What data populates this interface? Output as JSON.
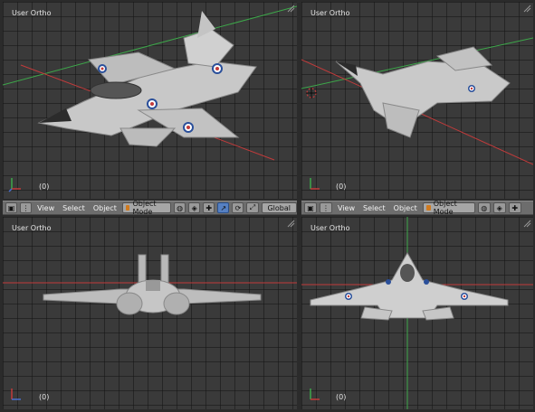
{
  "colors": {
    "viewport_bg": "#3a3a3a",
    "grid": "#202020",
    "header_bg": "#6d6d6d",
    "axis_red": "#c23b3b",
    "axis_green": "#3da84a",
    "mode_orange": "#d07a1f",
    "pressed_blue": "#5680c2"
  },
  "viewports": [
    {
      "title": "User Ortho",
      "frame": "(0)"
    },
    {
      "title": "User Ortho",
      "frame": "(0)"
    },
    {
      "title": "User Ortho",
      "frame": "(0)"
    },
    {
      "title": "User Ortho",
      "frame": "(0)"
    }
  ],
  "headers": [
    {
      "menus": [
        "View",
        "Select",
        "Object"
      ],
      "mode": "Object Mode",
      "orientation": "Global",
      "icons": [
        "editor-type-icon",
        "mode-cube-icon",
        "shading-sphere-icon",
        "pivot-icon",
        "manipulator-icon",
        "translate-icon",
        "rotate-icon",
        "scale-icon"
      ]
    },
    {
      "menus": [
        "View",
        "Select",
        "Object"
      ],
      "mode": "Object Mode",
      "icons": [
        "editor-type-icon",
        "mode-cube-icon",
        "shading-sphere-icon",
        "pivot-icon",
        "manipulator-icon"
      ]
    }
  ]
}
